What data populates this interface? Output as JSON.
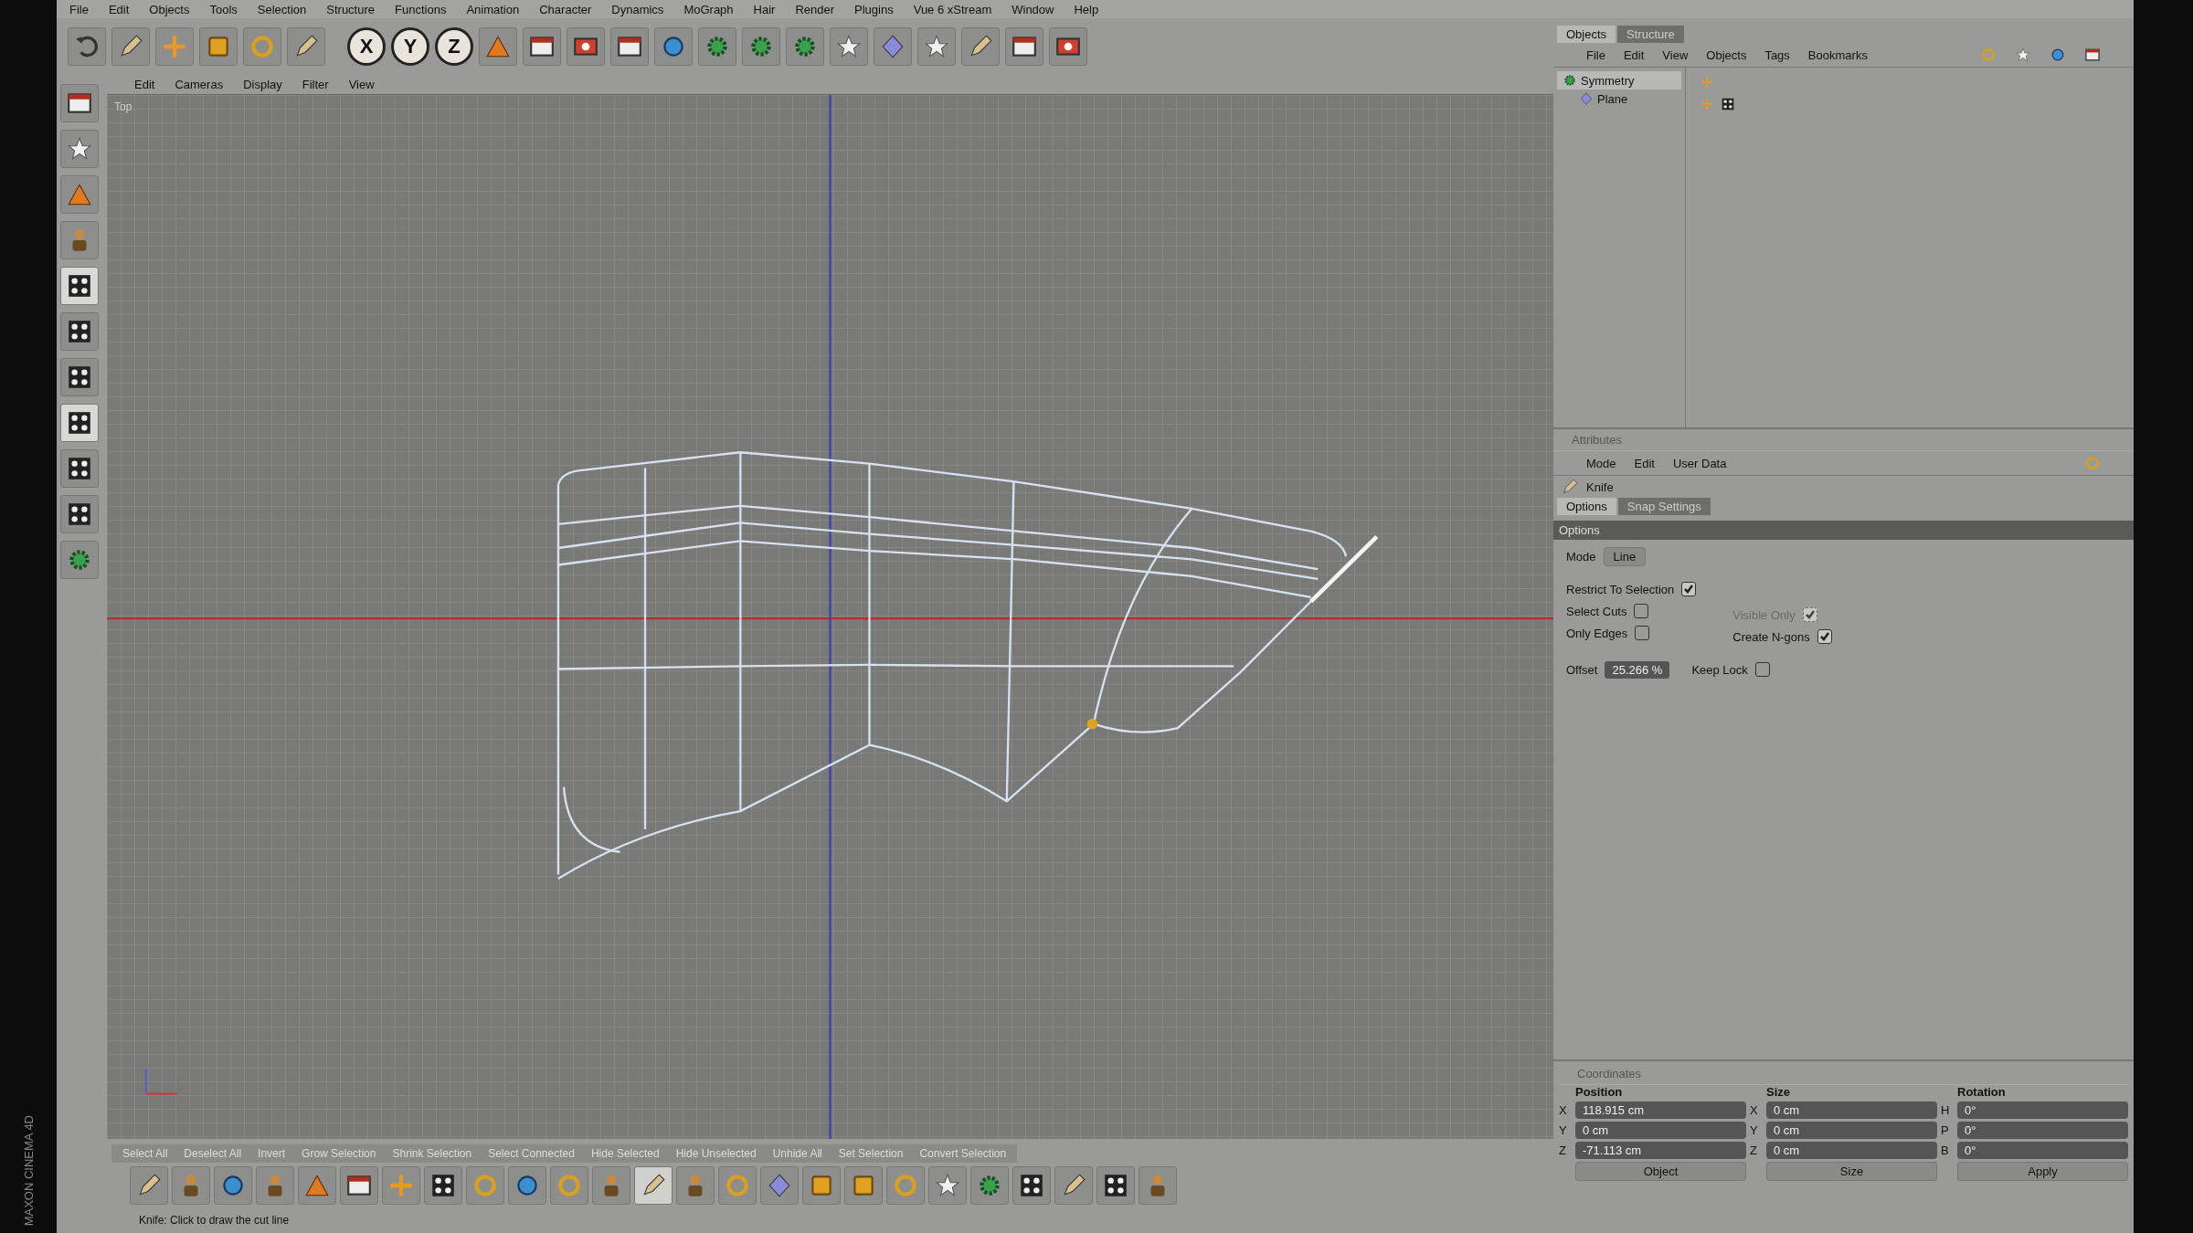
{
  "menubar": [
    "File",
    "Edit",
    "Objects",
    "Tools",
    "Selection",
    "Structure",
    "Functions",
    "Animation",
    "Character",
    "Dynamics",
    "MoGraph",
    "Hair",
    "Render",
    "Plugins",
    "Vue 6 xStream",
    "Window",
    "Help"
  ],
  "toolbar": {
    "axis_buttons": [
      {
        "label": "X",
        "on": true
      },
      {
        "label": "Y",
        "on": true
      },
      {
        "label": "Z",
        "on": true
      }
    ]
  },
  "viewport": {
    "menu": [
      "Edit",
      "Cameras",
      "Display",
      "Filter",
      "View"
    ],
    "label": "Top"
  },
  "object_manager": {
    "tabs": [
      {
        "label": "Objects",
        "selected": true
      },
      {
        "label": "Structure",
        "selected": false
      }
    ],
    "menu": [
      "File",
      "Edit",
      "View",
      "Objects",
      "Tags",
      "Bookmarks"
    ],
    "objects": [
      {
        "name": "Symmetry",
        "selected": true,
        "children": [
          {
            "name": "Plane",
            "selected": false
          }
        ]
      }
    ]
  },
  "attributes": {
    "title": "Attributes",
    "menu": [
      "Mode",
      "Edit",
      "User Data"
    ],
    "tool": "Knife",
    "tabs": [
      {
        "label": "Options",
        "selected": true
      },
      {
        "label": "Snap Settings",
        "selected": false
      }
    ],
    "section": "Options",
    "mode": {
      "label": "Mode",
      "value": "Line"
    },
    "left_options": [
      {
        "label": "Restrict To Selection",
        "checked": true,
        "disabled": false
      },
      {
        "label": "Select Cuts",
        "checked": false,
        "disabled": false
      },
      {
        "label": "Only Edges",
        "checked": false,
        "disabled": false
      }
    ],
    "right_options": [
      {
        "label": "Visible Only",
        "checked": true,
        "disabled": true
      },
      {
        "label": "Create N-gons",
        "checked": true,
        "disabled": false
      }
    ],
    "offset": {
      "label": "Offset",
      "value": "25.266 %"
    },
    "keep_lock": {
      "label": "Keep Lock",
      "checked": false
    }
  },
  "coordinates": {
    "title": "Coordinates",
    "headers": [
      "Position",
      "Size",
      "Rotation"
    ],
    "rows": [
      {
        "axes": [
          "X",
          "X",
          "H"
        ],
        "values": [
          "118.915 cm",
          "0 cm",
          "0°"
        ]
      },
      {
        "axes": [
          "Y",
          "Y",
          "P"
        ],
        "values": [
          "0 cm",
          "0 cm",
          "0°"
        ]
      },
      {
        "axes": [
          "Z",
          "Z",
          "B"
        ],
        "values": [
          "-71.113 cm",
          "0 cm",
          "0°"
        ]
      }
    ],
    "dropdowns": [
      "Object",
      "Size"
    ],
    "apply": "Apply"
  },
  "command_bar": [
    "Select All",
    "Deselect All",
    "Invert",
    "Grow Selection",
    "Shrink Selection",
    "Select Connected",
    "Hide Selected",
    "Hide Unselected",
    "Unhide All",
    "Set Selection",
    "Convert Selection"
  ],
  "status": "Knife: Click to draw the cut line",
  "brand": "MAXON CINEMA 4D"
}
